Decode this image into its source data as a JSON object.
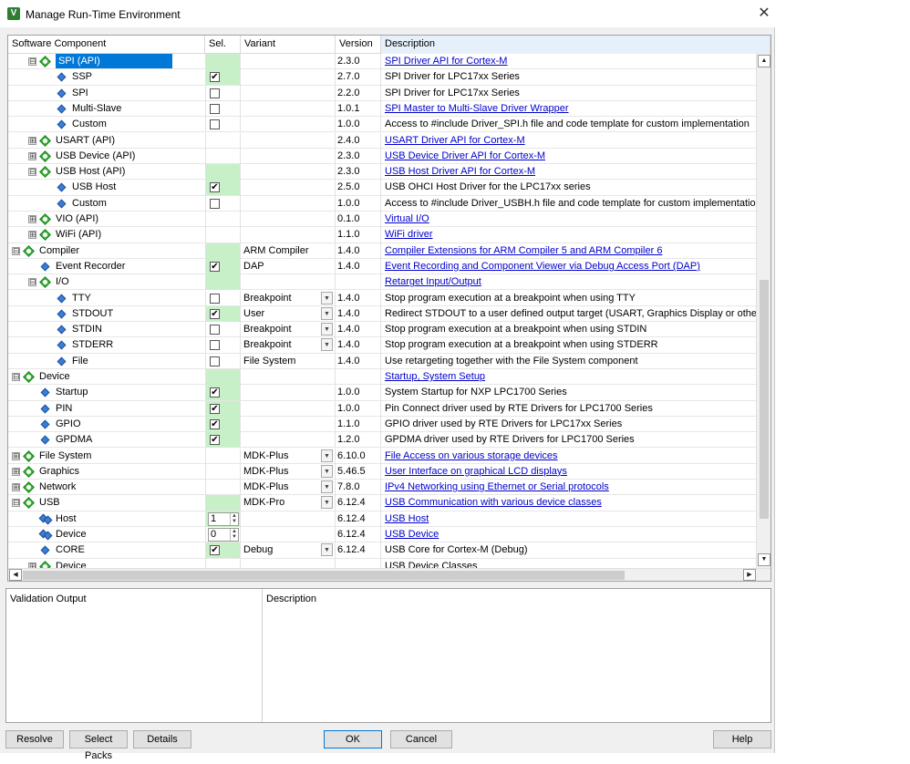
{
  "window": {
    "title": "Manage Run-Time Environment",
    "app_icon": "V",
    "close_glyph": "✕"
  },
  "columns": {
    "component": "Software Component",
    "sel": "Sel.",
    "variant": "Variant",
    "version": "Version",
    "description": "Description"
  },
  "rows": [
    {
      "name": "SPI (API)",
      "indent": 2,
      "exp": "⊟",
      "icon": "comp",
      "highlight": true,
      "sel": "",
      "green": true,
      "variant": "",
      "dd": false,
      "version": "2.3.0",
      "desc": "SPI Driver API for Cortex-M",
      "link": true
    },
    {
      "name": "SSP",
      "indent": 4,
      "exp": "",
      "icon": "leaf",
      "sel": "check",
      "checked": true,
      "green": true,
      "variant": "",
      "dd": false,
      "version": "2.7.0",
      "desc": "SPI Driver for LPC17xx Series",
      "link": false
    },
    {
      "name": "SPI",
      "indent": 4,
      "exp": "",
      "icon": "leaf",
      "sel": "check",
      "checked": false,
      "green": false,
      "variant": "",
      "dd": false,
      "version": "2.2.0",
      "desc": "SPI Driver for LPC17xx Series",
      "link": false
    },
    {
      "name": "Multi-Slave",
      "indent": 4,
      "exp": "",
      "icon": "leaf",
      "sel": "check",
      "checked": false,
      "green": false,
      "variant": "",
      "dd": false,
      "version": "1.0.1",
      "desc": "SPI Master to Multi-Slave Driver Wrapper",
      "link": true
    },
    {
      "name": "Custom",
      "indent": 4,
      "exp": "",
      "icon": "leaf",
      "sel": "check",
      "checked": false,
      "green": false,
      "variant": "",
      "dd": false,
      "version": "1.0.0",
      "desc": "Access to #include Driver_SPI.h file and code template for custom implementation",
      "link": false
    },
    {
      "name": "USART (API)",
      "indent": 2,
      "exp": "⊞",
      "icon": "comp",
      "sel": "",
      "green": false,
      "variant": "",
      "dd": false,
      "version": "2.4.0",
      "desc": "USART Driver API for Cortex-M",
      "link": true
    },
    {
      "name": "USB Device (API)",
      "indent": 2,
      "exp": "⊞",
      "icon": "comp",
      "sel": "",
      "green": false,
      "variant": "",
      "dd": false,
      "version": "2.3.0",
      "desc": "USB Device Driver API for Cortex-M",
      "link": true
    },
    {
      "name": "USB Host (API)",
      "indent": 2,
      "exp": "⊟",
      "icon": "comp",
      "sel": "",
      "green": true,
      "variant": "",
      "dd": false,
      "version": "2.3.0",
      "desc": "USB Host Driver API for Cortex-M",
      "link": true
    },
    {
      "name": "USB Host",
      "indent": 4,
      "exp": "",
      "icon": "leaf",
      "sel": "check",
      "checked": true,
      "green": true,
      "variant": "",
      "dd": false,
      "version": "2.5.0",
      "desc": "USB OHCI Host Driver for the LPC17xx series",
      "link": false
    },
    {
      "name": "Custom",
      "indent": 4,
      "exp": "",
      "icon": "leaf",
      "sel": "check",
      "checked": false,
      "green": false,
      "variant": "",
      "dd": false,
      "version": "1.0.0",
      "desc": "Access to #include Driver_USBH.h file and code template for custom implementation",
      "link": false
    },
    {
      "name": "VIO (API)",
      "indent": 2,
      "exp": "⊞",
      "icon": "comp",
      "sel": "",
      "green": false,
      "variant": "",
      "dd": false,
      "version": "0.1.0",
      "desc": "Virtual I/O",
      "link": true
    },
    {
      "name": "WiFi (API)",
      "indent": 2,
      "exp": "⊞",
      "icon": "comp",
      "sel": "",
      "green": false,
      "variant": "",
      "dd": false,
      "version": "1.1.0",
      "desc": "WiFi driver",
      "link": true
    },
    {
      "name": "Compiler",
      "indent": 0,
      "exp": "⊟",
      "icon": "comp",
      "sel": "",
      "green": true,
      "variant": "ARM Compiler",
      "dd": false,
      "version": "1.4.0",
      "desc": "Compiler Extensions for ARM Compiler 5 and ARM Compiler 6",
      "link": true
    },
    {
      "name": "Event Recorder",
      "indent": 2,
      "exp": "",
      "icon": "leaf",
      "sel": "check",
      "checked": true,
      "green": true,
      "variant": "DAP",
      "dd": false,
      "version": "1.4.0",
      "desc": "Event Recording and Component Viewer via Debug Access Port (DAP)",
      "link": true
    },
    {
      "name": "I/O",
      "indent": 2,
      "exp": "⊟",
      "icon": "comp",
      "sel": "",
      "green": true,
      "variant": "",
      "dd": false,
      "version": "",
      "desc": "Retarget Input/Output",
      "link": true
    },
    {
      "name": "TTY",
      "indent": 4,
      "exp": "",
      "icon": "leaf",
      "sel": "check",
      "checked": false,
      "green": false,
      "variant": "Breakpoint",
      "dd": true,
      "version": "1.4.0",
      "desc": "Stop program execution at a breakpoint when using TTY",
      "link": false
    },
    {
      "name": "STDOUT",
      "indent": 4,
      "exp": "",
      "icon": "leaf",
      "sel": "check",
      "checked": true,
      "green": true,
      "variant": "User",
      "dd": true,
      "version": "1.4.0",
      "desc": "Redirect STDOUT to a user defined output target (USART, Graphics Display or other)",
      "link": false
    },
    {
      "name": "STDIN",
      "indent": 4,
      "exp": "",
      "icon": "leaf",
      "sel": "check",
      "checked": false,
      "green": false,
      "variant": "Breakpoint",
      "dd": true,
      "version": "1.4.0",
      "desc": "Stop program execution at a breakpoint when using STDIN",
      "link": false
    },
    {
      "name": "STDERR",
      "indent": 4,
      "exp": "",
      "icon": "leaf",
      "sel": "check",
      "checked": false,
      "green": false,
      "variant": "Breakpoint",
      "dd": true,
      "version": "1.4.0",
      "desc": "Stop program execution at a breakpoint when using STDERR",
      "link": false
    },
    {
      "name": "File",
      "indent": 4,
      "exp": "",
      "icon": "leaf",
      "sel": "check",
      "checked": false,
      "green": false,
      "variant": "File System",
      "dd": false,
      "version": "1.4.0",
      "desc": "Use retargeting together with the File System component",
      "link": false
    },
    {
      "name": "Device",
      "indent": 0,
      "exp": "⊟",
      "icon": "comp",
      "sel": "",
      "green": true,
      "variant": "",
      "dd": false,
      "version": "",
      "desc": "Startup, System Setup",
      "link": true
    },
    {
      "name": "Startup",
      "indent": 2,
      "exp": "",
      "icon": "leaf",
      "sel": "check",
      "checked": true,
      "green": true,
      "variant": "",
      "dd": false,
      "version": "1.0.0",
      "desc": "System Startup for NXP LPC1700 Series",
      "link": false
    },
    {
      "name": "PIN",
      "indent": 2,
      "exp": "",
      "icon": "leaf",
      "sel": "check",
      "checked": true,
      "green": true,
      "variant": "",
      "dd": false,
      "version": "1.0.0",
      "desc": "Pin Connect driver used by RTE Drivers for LPC1700 Series",
      "link": false
    },
    {
      "name": "GPIO",
      "indent": 2,
      "exp": "",
      "icon": "leaf",
      "sel": "check",
      "checked": true,
      "green": true,
      "variant": "",
      "dd": false,
      "version": "1.1.0",
      "desc": "GPIO driver used by RTE Drivers for LPC17xx Series",
      "link": false
    },
    {
      "name": "GPDMA",
      "indent": 2,
      "exp": "",
      "icon": "leaf",
      "sel": "check",
      "checked": true,
      "green": true,
      "variant": "",
      "dd": false,
      "version": "1.2.0",
      "desc": "GPDMA driver used by RTE Drivers for LPC1700 Series",
      "link": false
    },
    {
      "name": "File System",
      "indent": 0,
      "exp": "⊞",
      "icon": "comp",
      "sel": "",
      "green": false,
      "variant": "MDK-Plus",
      "dd": true,
      "version": "6.10.0",
      "desc": "File Access on various storage devices",
      "link": true
    },
    {
      "name": "Graphics",
      "indent": 0,
      "exp": "⊞",
      "icon": "comp",
      "sel": "",
      "green": false,
      "variant": "MDK-Plus",
      "dd": true,
      "version": "5.46.5",
      "desc": "User Interface on graphical LCD displays",
      "link": true
    },
    {
      "name": "Network",
      "indent": 0,
      "exp": "⊞",
      "icon": "comp",
      "sel": "",
      "green": false,
      "variant": "MDK-Plus",
      "dd": true,
      "version": "7.8.0",
      "desc": "IPv4 Networking using Ethernet or Serial protocols",
      "link": true
    },
    {
      "name": "USB",
      "indent": 0,
      "exp": "⊟",
      "icon": "comp",
      "sel": "",
      "green": true,
      "variant": "MDK-Pro",
      "dd": true,
      "version": "6.12.4",
      "desc": "USB Communication with various device classes",
      "link": true
    },
    {
      "name": "Host",
      "indent": 2,
      "exp": "",
      "icon": "multi",
      "sel": "spin",
      "spin": "1",
      "green": true,
      "variant": "",
      "dd": false,
      "version": "6.12.4",
      "desc": "USB Host",
      "link": true
    },
    {
      "name": "Device",
      "indent": 2,
      "exp": "",
      "icon": "multi",
      "sel": "spin",
      "spin": "0",
      "green": false,
      "variant": "",
      "dd": false,
      "version": "6.12.4",
      "desc": "USB Device",
      "link": true
    },
    {
      "name": "CORE",
      "indent": 2,
      "exp": "",
      "icon": "leaf",
      "sel": "check",
      "checked": true,
      "green": true,
      "variant": "Debug",
      "dd": true,
      "version": "6.12.4",
      "desc": "USB Core for Cortex-M (Debug)",
      "link": false
    },
    {
      "name": "Device",
      "indent": 2,
      "exp": "⊞",
      "icon": "comp",
      "sel": "",
      "green": false,
      "variant": "",
      "dd": false,
      "version": "",
      "desc": "USB Device Classes",
      "link": false
    }
  ],
  "validation": {
    "col1": "Validation Output",
    "col2": "Description"
  },
  "buttons": {
    "resolve": "Resolve",
    "select_packs": "Select Packs",
    "details": "Details",
    "ok": "OK",
    "cancel": "Cancel",
    "help": "Help"
  },
  "glyphs": {
    "check": "✔",
    "spin_up": "▲",
    "spin_down": "▼",
    "dropdown": "▼",
    "scroll_up": "▲",
    "scroll_down": "▼",
    "scroll_left": "◀",
    "scroll_right": "▶"
  },
  "colors": {
    "selection_highlight": "#0078d7",
    "selected_green": "#c8f0c8",
    "link": "#0000cc",
    "description_header": "#e5f0fb"
  }
}
